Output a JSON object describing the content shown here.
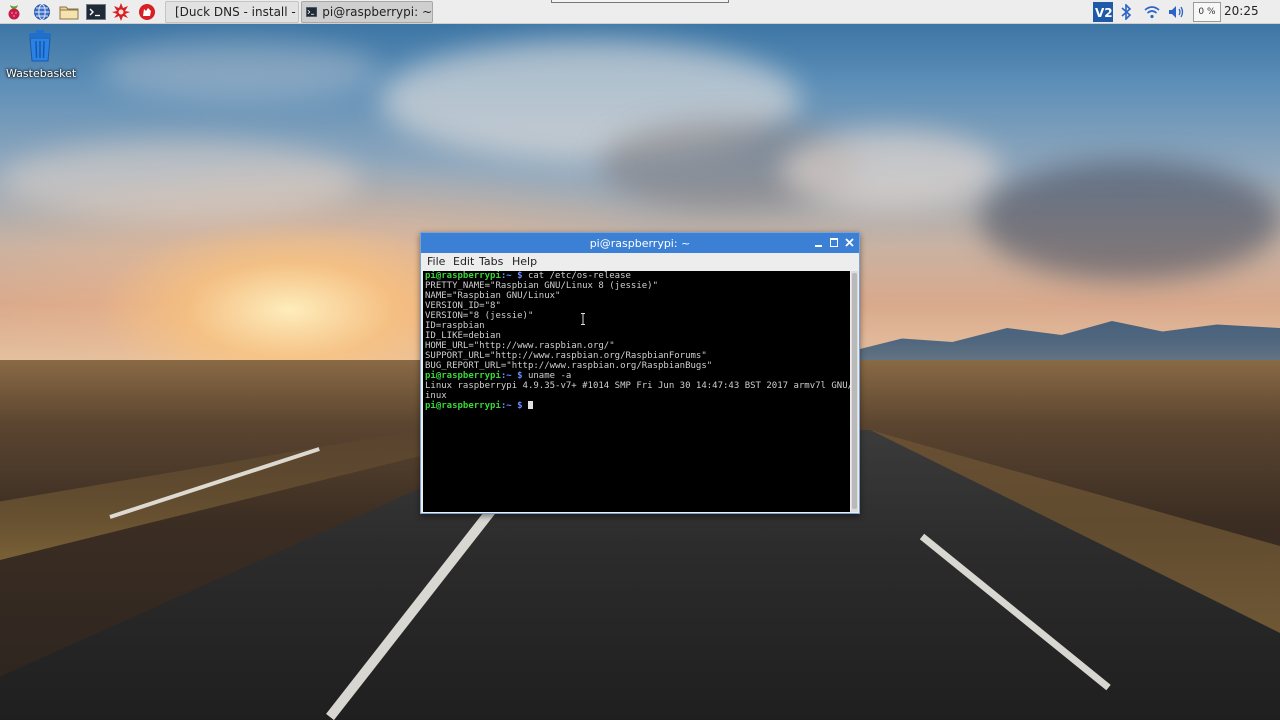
{
  "taskbar": {
    "launchers": [
      {
        "name": "raspberry-menu",
        "icon": "raspberry-icon"
      },
      {
        "name": "web-browser",
        "icon": "globe-icon"
      },
      {
        "name": "file-manager",
        "icon": "folder-icon"
      },
      {
        "name": "terminal",
        "icon": "terminal-icon"
      },
      {
        "name": "mathematica",
        "icon": "star-burst-icon"
      },
      {
        "name": "wolfram",
        "icon": "wolf-icon"
      }
    ],
    "tasks": [
      {
        "label": "[Duck DNS - install - ...",
        "icon": "chromium-icon",
        "active": false
      },
      {
        "label": "pi@raspberrypi: ~",
        "icon": "terminal-icon",
        "active": true
      }
    ],
    "tray": {
      "vnc_icon": "vnc-icon",
      "bluetooth_icon": "bluetooth-icon",
      "wifi_icon": "wifi-icon",
      "volume_icon": "volume-icon",
      "cpu_usage": "0 %",
      "clock": "20:25"
    }
  },
  "desktop": {
    "icons": [
      {
        "label": "Wastebasket",
        "icon": "trash-icon"
      }
    ]
  },
  "terminal": {
    "title": "pi@raspberrypi: ~",
    "menu": [
      "File",
      "Edit",
      "Tabs",
      "Help"
    ],
    "prompt_user": "pi@raspberrypi",
    "prompt_path": ":~ $",
    "commands": [
      "cat /etc/os-release",
      "uname -a"
    ],
    "output": [
      "PRETTY_NAME=\"Raspbian GNU/Linux 8 (jessie)\"",
      "NAME=\"Raspbian GNU/Linux\"",
      "VERSION_ID=\"8\"",
      "VERSION=\"8 (jessie)\"",
      "ID=raspbian",
      "ID_LIKE=debian",
      "HOME_URL=\"http://www.raspbian.org/\"",
      "SUPPORT_URL=\"http://www.raspbian.org/RaspbianForums\"",
      "BUG_REPORT_URL=\"http://www.raspbian.org/RaspbianBugs\""
    ],
    "uname_output": [
      "Linux raspberrypi 4.9.35-v7+ #1014 SMP Fri Jun 30 14:47:43 BST 2017 armv7l GNU/L",
      "inux"
    ]
  },
  "colors": {
    "titlebar": "#3c80d6",
    "prompt_user": "#3bd53b",
    "prompt_path": "#6c8cff",
    "console_bg": "#000000"
  }
}
